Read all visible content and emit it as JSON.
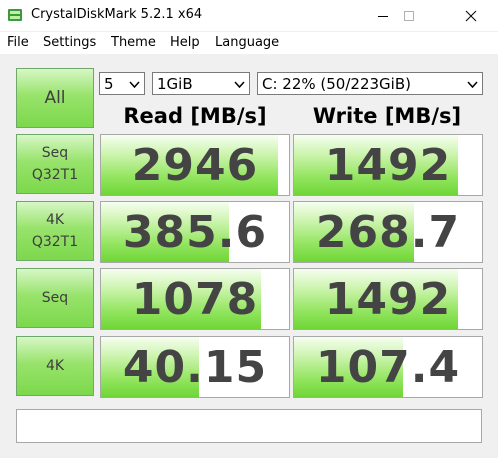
{
  "window": {
    "title": "CrystalDiskMark 5.2.1 x64"
  },
  "menu": {
    "items": [
      "File",
      "Settings",
      "Theme",
      "Help",
      "Language"
    ]
  },
  "toolbar": {
    "all_label": "All",
    "count_select": "5",
    "size_select": "1GiB",
    "drive_select": "C: 22% (50/223GiB)"
  },
  "columns": {
    "read": "Read [MB/s]",
    "write": "Write [MB/s]"
  },
  "tests": [
    {
      "label": "Seq\nQ32T1",
      "read": "2946",
      "write": "1492",
      "read_fill": 0.94,
      "write_fill": 0.87
    },
    {
      "label": "4K\nQ32T1",
      "read": "385.6",
      "write": "268.7",
      "read_fill": 0.68,
      "write_fill": 0.64
    },
    {
      "label": "Seq",
      "read": "1078",
      "write": "1492",
      "read_fill": 0.85,
      "write_fill": 0.87
    },
    {
      "label": "4K",
      "read": "40.15",
      "write": "107.4",
      "read_fill": 0.52,
      "write_fill": 0.58
    }
  ],
  "comment": "",
  "colors": {
    "accent_green": "#7cd84c",
    "value_text": "#444444"
  }
}
